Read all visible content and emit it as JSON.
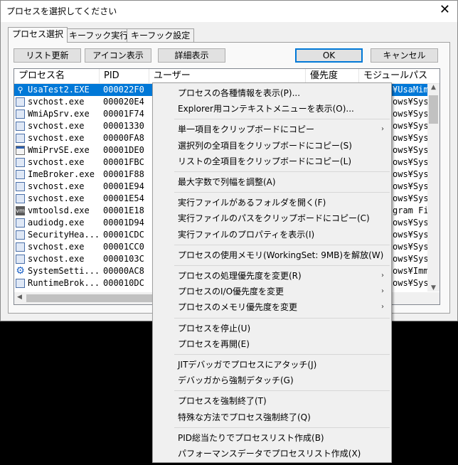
{
  "window": {
    "title": "プロセスを選択してください",
    "close_label": "✕"
  },
  "tabs": [
    "プロセス選択",
    "キーフック実行",
    "キーフック設定"
  ],
  "buttons": {
    "refresh": "リスト更新",
    "icon_view": "アイコン表示",
    "detail_view": "詳細表示",
    "ok": "OK",
    "cancel": "キャンセル"
  },
  "columns": [
    "プロセス名",
    "PID",
    "ユーザー",
    "優先度",
    "モジュールパス"
  ],
  "rows": [
    {
      "icon": "process-icon",
      "name": "UsaTest2.EXE",
      "pid": "000022F0",
      "module": "¥UsaMim",
      "selected": true
    },
    {
      "icon": "service-icon",
      "name": "svchost.exe",
      "pid": "000020E4",
      "module": "ows¥Sys"
    },
    {
      "icon": "service-icon",
      "name": "WmiApSrv.exe",
      "pid": "00001F74",
      "module": "ows¥Sys"
    },
    {
      "icon": "service-icon",
      "name": "svchost.exe",
      "pid": "00001330",
      "module": "ows¥Sys"
    },
    {
      "icon": "service-icon",
      "name": "svchost.exe",
      "pid": "00000FA8",
      "module": "ows¥Sys"
    },
    {
      "icon": "wmi-icon",
      "name": "WmiPrvSE.exe",
      "pid": "00001DE0",
      "module": "ows¥Sys"
    },
    {
      "icon": "service-icon",
      "name": "svchost.exe",
      "pid": "00001FBC",
      "module": "ows¥Sys"
    },
    {
      "icon": "service-icon",
      "name": "ImeBroker.exe",
      "pid": "00001F88",
      "module": "ows¥Sys"
    },
    {
      "icon": "service-icon",
      "name": "svchost.exe",
      "pid": "00001E94",
      "module": "ows¥Sys"
    },
    {
      "icon": "service-icon",
      "name": "svchost.exe",
      "pid": "00001E54",
      "module": "ows¥Sys"
    },
    {
      "icon": "vmtools-icon",
      "name": "vmtoolsd.exe",
      "pid": "00001E18",
      "module": "gram Fi"
    },
    {
      "icon": "service-icon",
      "name": "audiodg.exe",
      "pid": "00001D94",
      "module": "ows¥Sys"
    },
    {
      "icon": "service-icon",
      "name": "SecurityHea...",
      "pid": "00001CDC",
      "module": "ows¥Sys"
    },
    {
      "icon": "service-icon",
      "name": "svchost.exe",
      "pid": "00001CC0",
      "module": "ows¥Sys"
    },
    {
      "icon": "service-icon",
      "name": "svchost.exe",
      "pid": "0000103C",
      "module": "ows¥Sys"
    },
    {
      "icon": "settings-gear-icon",
      "name": "SystemSetti...",
      "pid": "00000AC8",
      "module": "ows¥Imm"
    },
    {
      "icon": "service-icon",
      "name": "RuntimeBrok...",
      "pid": "000010DC",
      "module": "ows¥Sys"
    }
  ],
  "context_menu": {
    "groups": [
      [
        {
          "label": "プロセスの各種情報を表示(P)...",
          "submenu": false
        },
        {
          "label": "Explorer用コンテキストメニューを表示(O)...",
          "submenu": false
        }
      ],
      [
        {
          "label": "単一項目をクリップボードにコピー",
          "submenu": true
        },
        {
          "label": "選択列の全項目をクリップボードにコピー(S)",
          "submenu": false
        },
        {
          "label": "リストの全項目をクリップボードにコピー(L)",
          "submenu": false
        }
      ],
      [
        {
          "label": "最大字数で列幅を調整(A)",
          "submenu": false
        }
      ],
      [
        {
          "label": "実行ファイルがあるフォルダを開く(F)",
          "submenu": false
        },
        {
          "label": "実行ファイルのパスをクリップボードにコピー(C)",
          "submenu": false
        },
        {
          "label": "実行ファイルのプロパティを表示(I)",
          "submenu": false
        }
      ],
      [
        {
          "label": "プロセスの使用メモリ(WorkingSet: 9MB)を解放(W)",
          "submenu": false
        }
      ],
      [
        {
          "label": "プロセスの処理優先度を変更(R)",
          "submenu": true
        },
        {
          "label": "プロセスのI/O優先度を変更",
          "submenu": true
        },
        {
          "label": "プロセスのメモリ優先度を変更",
          "submenu": true
        }
      ],
      [
        {
          "label": "プロセスを停止(U)",
          "submenu": false
        },
        {
          "label": "プロセスを再開(E)",
          "submenu": false
        }
      ],
      [
        {
          "label": "JITデバッガでプロセスにアタッチ(J)",
          "submenu": false
        },
        {
          "label": "デバッガから強制デタッチ(G)",
          "submenu": false
        }
      ],
      [
        {
          "label": "プロセスを強制終了(T)",
          "submenu": false
        },
        {
          "label": "特殊な方法でプロセス強制終了(Q)",
          "submenu": false
        }
      ],
      [
        {
          "label": "PID総当たりでプロセスリスト作成(B)",
          "submenu": false
        },
        {
          "label": "パフォーマンスデータでプロセスリスト作成(X)",
          "submenu": false
        }
      ]
    ]
  },
  "colors": {
    "selection": "#0078d7",
    "window_bg": "#f0f0f0",
    "menu_bg": "#f0f0f0"
  }
}
